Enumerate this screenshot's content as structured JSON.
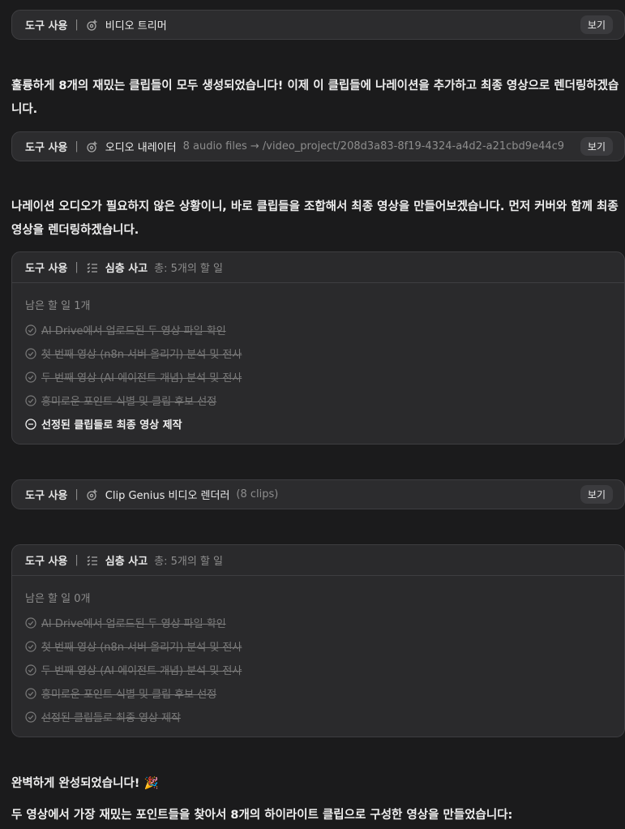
{
  "tool_label": "도구 사용",
  "view_label": "보기",
  "tools": [
    {
      "name": "비디오 트리머",
      "detail": ""
    },
    {
      "name": "오디오 내레이터",
      "detail": "8 audio files → /video_project/208d3a83-8f19-4324-a4d2-a21cbd9e44c9"
    },
    {
      "name": "Clip Genius 비디오 렌더러",
      "detail": "(8 clips)"
    }
  ],
  "messages": {
    "msg1": "훌륭하게 8개의 재밌는 클립들이 모두 생성되었습니다! 이제 이 클립들에 나레이션을 추가하고 최종 영상으로 렌더링하겠습니다.",
    "msg2": "나레이션 오디오가 필요하지 않은 상황이니, 바로 클립들을 조합해서 최종 영상을 만들어보겠습니다. 먼저 커버와 함께 최종 영상을 렌더링하겠습니다.",
    "msg3": "완벽하게 완성되었습니다! 🎉",
    "msg4": "두 영상에서 가장 재밌는 포인트들을 찾아서 8개의 하이라이트 클립으로 구성한 영상을 만들었습니다:"
  },
  "todos": [
    {
      "title": "심층 사고",
      "count": "총: 5개의 할 일",
      "remaining": "남은 할 일 1개",
      "items": [
        {
          "text": "AI Drive에서 업로드된 두 영상 파일 확인",
          "status": "done"
        },
        {
          "text": "첫 번째 영상 (n8n 서버 올리기) 분석 및 전사",
          "status": "done"
        },
        {
          "text": "두 번째 영상 (AI 에이전트 개념) 분석 및 전사",
          "status": "done"
        },
        {
          "text": "흥미로운 포인트 식별 및 클립 후보 선정",
          "status": "done"
        },
        {
          "text": "선정된 클립들로 최종 영상 제작",
          "status": "in-progress"
        }
      ]
    },
    {
      "title": "심층 사고",
      "count": "총: 5개의 할 일",
      "remaining": "남은 할 일 0개",
      "items": [
        {
          "text": "AI Drive에서 업로드된 두 영상 파일 확인",
          "status": "done"
        },
        {
          "text": "첫 번째 영상 (n8n 서버 올리기) 분석 및 전사",
          "status": "done"
        },
        {
          "text": "두 번째 영상 (AI 에이전트 개념) 분석 및 전사",
          "status": "done"
        },
        {
          "text": "흥미로운 포인트 식별 및 클립 후보 선정",
          "status": "done"
        },
        {
          "text": "선정된 클립들로 최종 영상 제작",
          "status": "done"
        }
      ]
    }
  ],
  "icons": {
    "tool": "gear-spark-icon",
    "todo": "checklist-icon",
    "done": "check-circle-icon",
    "in_progress": "minus-circle-icon"
  }
}
